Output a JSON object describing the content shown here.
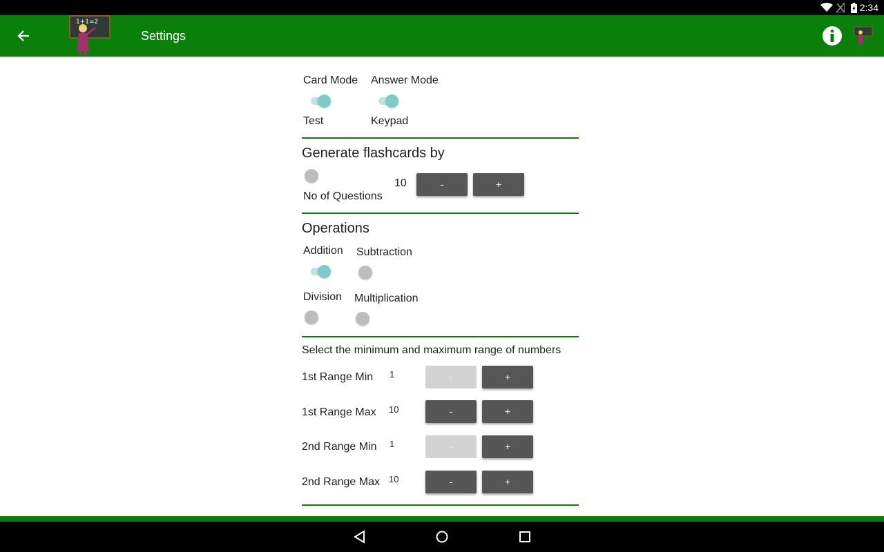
{
  "status": {
    "time": "2:34"
  },
  "appbar": {
    "title": "Settings"
  },
  "mode": {
    "card_mode_label": "Card Mode",
    "answer_mode_label": "Answer Mode",
    "card_mode_value": "Test",
    "answer_mode_value": "Keypad"
  },
  "generate": {
    "heading": "Generate flashcards by",
    "option_label": "No of Questions",
    "count": "10",
    "minus": "-",
    "plus": "+"
  },
  "operations": {
    "heading": "Operations",
    "addition": "Addition",
    "subtraction": "Subtraction",
    "division": "Division",
    "multiplication": "Multiplication"
  },
  "range": {
    "heading": "Select the minimum and maximum range of numbers",
    "rows": [
      {
        "label": "1st Range Min",
        "value": "1",
        "minus": "-",
        "plus": "+"
      },
      {
        "label": "1st Range Max",
        "value": "10",
        "minus": "-",
        "plus": "+"
      },
      {
        "label": "2nd Range Min",
        "value": "1",
        "minus": "-",
        "plus": "+"
      },
      {
        "label": "2nd Range Max",
        "value": "10",
        "minus": "-",
        "plus": "+"
      }
    ]
  },
  "colors": {
    "primary": "#0a800a",
    "switch_on": "#7dcbc6",
    "button": "#565656"
  }
}
